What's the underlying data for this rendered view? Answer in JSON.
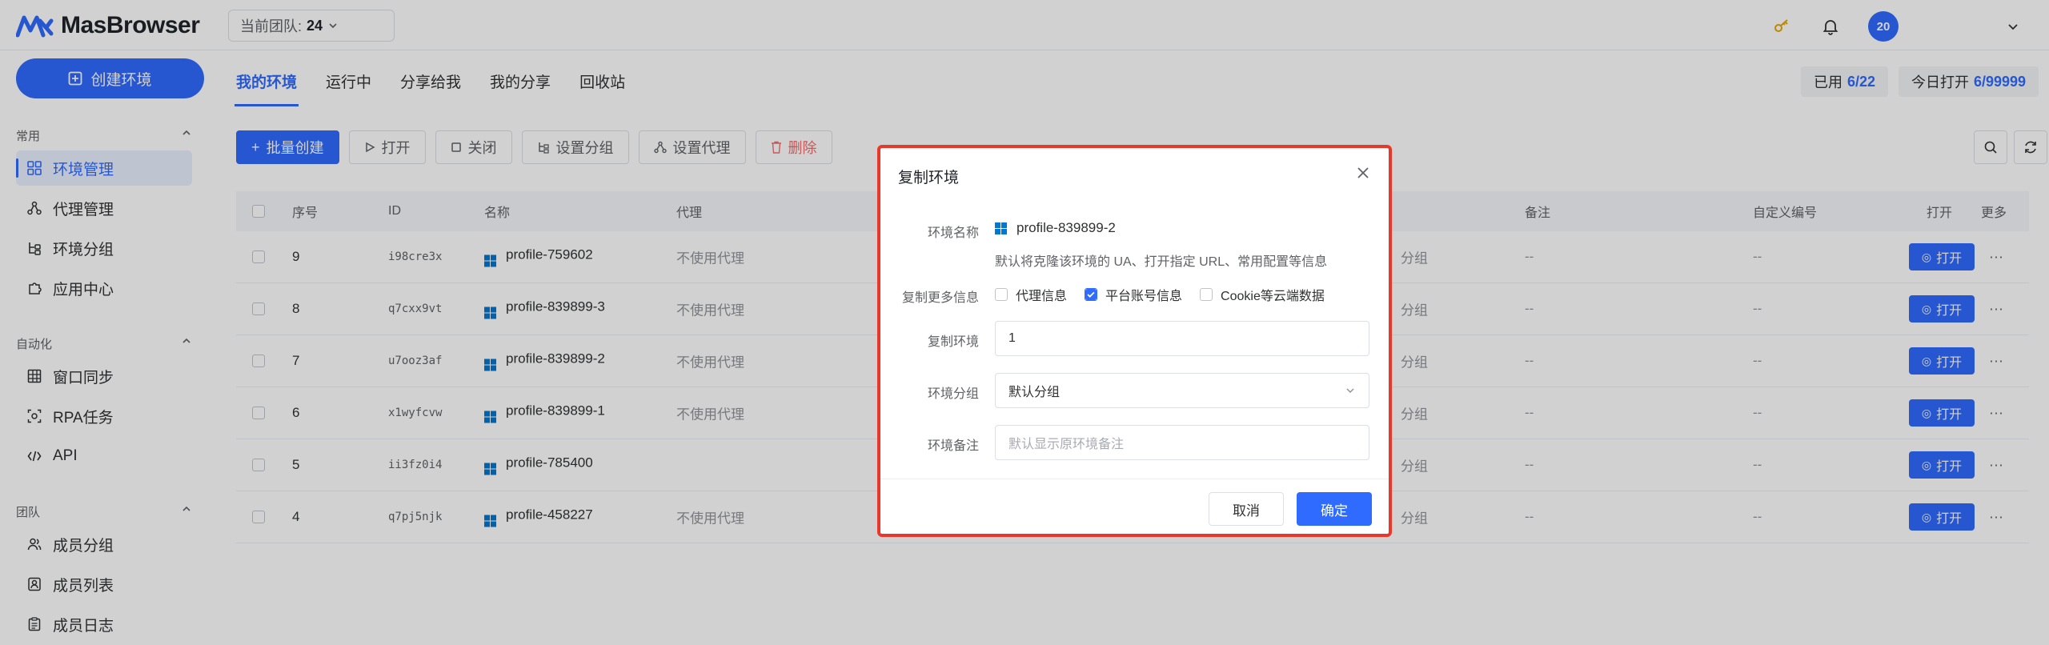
{
  "brand": {
    "name": "MasBrowser",
    "accent": "#2f6bff"
  },
  "header": {
    "team_label": "当前团队:",
    "team_value": "24",
    "avatar_text": "20"
  },
  "sidebar": {
    "create_label": "创建环境",
    "groups": [
      {
        "title": "常用",
        "items": [
          "环境管理",
          "代理管理",
          "环境分组",
          "应用中心"
        ]
      },
      {
        "title": "自动化",
        "items": [
          "窗口同步",
          "RPA任务",
          "API"
        ]
      },
      {
        "title": "团队",
        "items": [
          "成员分组",
          "成员列表",
          "成员日志"
        ]
      }
    ]
  },
  "tabs": [
    "我的环境",
    "运行中",
    "分享给我",
    "我的分享",
    "回收站"
  ],
  "quota": {
    "used_label": "已用",
    "used_value": "6/22",
    "today_label": "今日打开",
    "today_value": "6/99999"
  },
  "toolbar": {
    "batch_create": "批量创建",
    "open": "打开",
    "close": "关闭",
    "set_group": "设置分组",
    "set_proxy": "设置代理",
    "delete": "删除"
  },
  "table": {
    "headers": {
      "seq": "序号",
      "id": "ID",
      "name": "名称",
      "proxy": "代理",
      "remark": "备注",
      "custom_no": "自定义编号",
      "open": "打开",
      "more": "更多"
    },
    "rows": [
      {
        "seq": "9",
        "id": "i98cre3x",
        "name": "profile-759602",
        "proxy": "不使用代理",
        "group": "分组",
        "remark": "--",
        "custom": "--",
        "open": "打开"
      },
      {
        "seq": "8",
        "id": "q7cxx9vt",
        "name": "profile-839899-3",
        "proxy": "不使用代理",
        "group": "分组",
        "remark": "--",
        "custom": "--",
        "open": "打开"
      },
      {
        "seq": "7",
        "id": "u7ooz3af",
        "name": "profile-839899-2",
        "proxy": "不使用代理",
        "group": "分组",
        "remark": "--",
        "custom": "--",
        "open": "打开"
      },
      {
        "seq": "6",
        "id": "x1wyfcvw",
        "name": "profile-839899-1",
        "proxy": "不使用代理",
        "group": "分组",
        "remark": "--",
        "custom": "--",
        "open": "打开"
      },
      {
        "seq": "5",
        "id": "ii3fz0i4",
        "name": "profile-785400",
        "proxy": "",
        "group": "分组",
        "remark": "--",
        "custom": "--",
        "open": "打开"
      },
      {
        "seq": "4",
        "id": "q7pj5njk",
        "name": "profile-458227",
        "proxy": "不使用代理",
        "group": "分组",
        "remark": "--",
        "custom": "--",
        "open": "打开"
      }
    ]
  },
  "dialog": {
    "title": "复制环境",
    "name_label": "环境名称",
    "name_value": "profile-839899-2",
    "hint": "默认将克隆该环境的 UA、打开指定 URL、常用配置等信息",
    "more_label": "复制更多信息",
    "options": [
      {
        "label": "代理信息",
        "checked": false
      },
      {
        "label": "平台账号信息",
        "checked": true
      },
      {
        "label": "Cookie等云端数据",
        "checked": false
      }
    ],
    "count_label": "复制环境",
    "count_value": "1",
    "group_label": "环境分组",
    "group_value": "默认分组",
    "remark_label": "环境备注",
    "remark_placeholder": "默认显示原环境备注",
    "cancel": "取消",
    "ok": "确定"
  }
}
